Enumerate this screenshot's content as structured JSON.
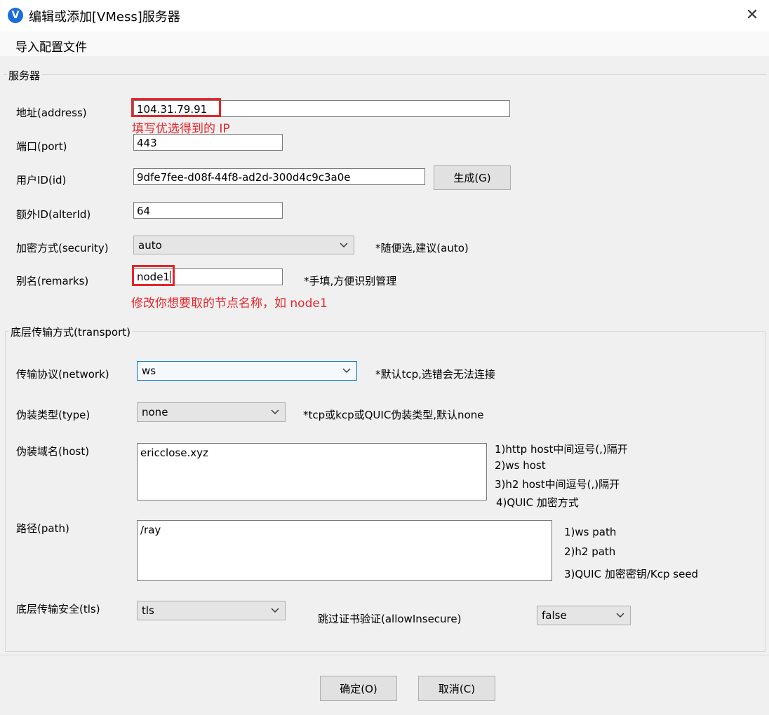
{
  "window": {
    "title": "编辑或添加[VMess]服务器",
    "app_icon": "v2rayn-logo-icon",
    "close_glyph": "✕"
  },
  "menu": {
    "import_label": "导入配置文件"
  },
  "server": {
    "group_label": "服务器",
    "address_label": "地址(address)",
    "address_value": "104.31.79.91",
    "address_annotation": "填写优选得到的 IP",
    "port_label": "端口(port)",
    "port_value": "443",
    "id_label": "用户ID(id)",
    "id_value": "9dfe7fee-d08f-44f8-ad2d-300d4c9c3a0e",
    "generate_label": "生成(G)",
    "alterid_label": "额外ID(alterId)",
    "alterid_value": "64",
    "security_label": "加密方式(security)",
    "security_value": "auto",
    "security_note": "*随便选,建议(auto)",
    "remarks_label": "别名(remarks)",
    "remarks_value": "node1",
    "remarks_note": "*手填,方便识别管理",
    "remarks_annotation": "修改你想要取的节点名称，如 node1"
  },
  "transport": {
    "group_label": "底层传输方式(transport)",
    "network_label": "传输协议(network)",
    "network_value": "ws",
    "network_note": "*默认tcp,选错会无法连接",
    "type_label": "伪装类型(type)",
    "type_value": "none",
    "type_note": "*tcp或kcp或QUIC伪装类型,默认none",
    "host_label": "伪装域名(host)",
    "host_value": "ericclose.xyz",
    "host_notes": [
      "1)http host中间逗号(,)隔开",
      "2)ws host",
      "3)h2 host中间逗号(,)隔开",
      "4)QUIC 加密方式"
    ],
    "path_label": "路径(path)",
    "path_value": "/ray",
    "path_notes": [
      "1)ws path",
      "2)h2 path",
      "3)QUIC 加密密钥/Kcp seed"
    ],
    "tls_label": "底层传输安全(tls)",
    "tls_value": "tls",
    "allow_insecure_label": "跳过证书验证(allowInsecure)",
    "allow_insecure_value": "false"
  },
  "footer": {
    "ok_label": "确定(O)",
    "cancel_label": "取消(C)"
  },
  "colors": {
    "annotation_red": "#e5262a",
    "focus_blue": "#0078d7",
    "accent": "#1a6fd6"
  }
}
